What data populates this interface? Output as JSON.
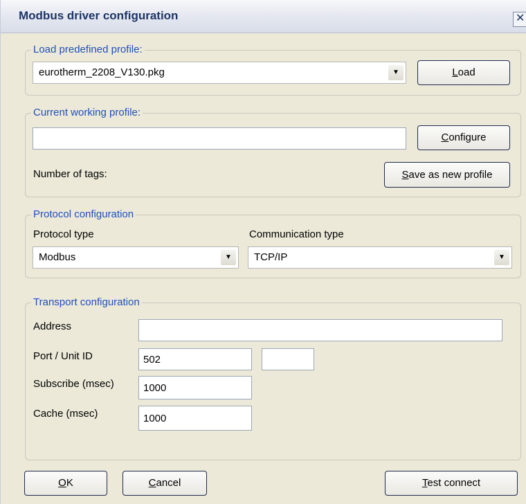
{
  "dialog": {
    "title": "Modbus driver configuration",
    "close_glyph": "✕"
  },
  "load_profile": {
    "legend": "Load predefined profile:",
    "selected_value": "eurotherm_2208_V130.pkg",
    "load_button": {
      "access_key": "L",
      "rest": "oad"
    }
  },
  "current_profile": {
    "legend": "Current working profile:",
    "name_value": "",
    "configure_button": {
      "access_key": "C",
      "rest": "onfigure"
    },
    "tags_label": "Number of tags:",
    "save_button": {
      "access_key": "S",
      "rest": "ave as new profile"
    }
  },
  "protocol": {
    "legend": "Protocol configuration",
    "protocol_type_label": "Protocol type",
    "protocol_type_value": "Modbus",
    "comm_type_label": "Communication type",
    "comm_type_value": "TCP/IP"
  },
  "transport": {
    "legend": "Transport configuration",
    "address_label": "Address",
    "address_value": "",
    "port_label": "Port / Unit ID",
    "port_value": "502",
    "unit_id_value": "",
    "subscribe_label": "Subscribe (msec)",
    "subscribe_value": "1000",
    "cache_label": "Cache (msec)",
    "cache_value": "1000"
  },
  "footer": {
    "ok_button": {
      "access_key": "O",
      "rest": "K"
    },
    "cancel_button": {
      "access_key": "C",
      "rest": "ancel"
    },
    "test_button": {
      "access_key": "T",
      "rest": "est connect"
    }
  },
  "icons": {
    "dropdown_arrow": "▼",
    "close": "close-icon"
  }
}
